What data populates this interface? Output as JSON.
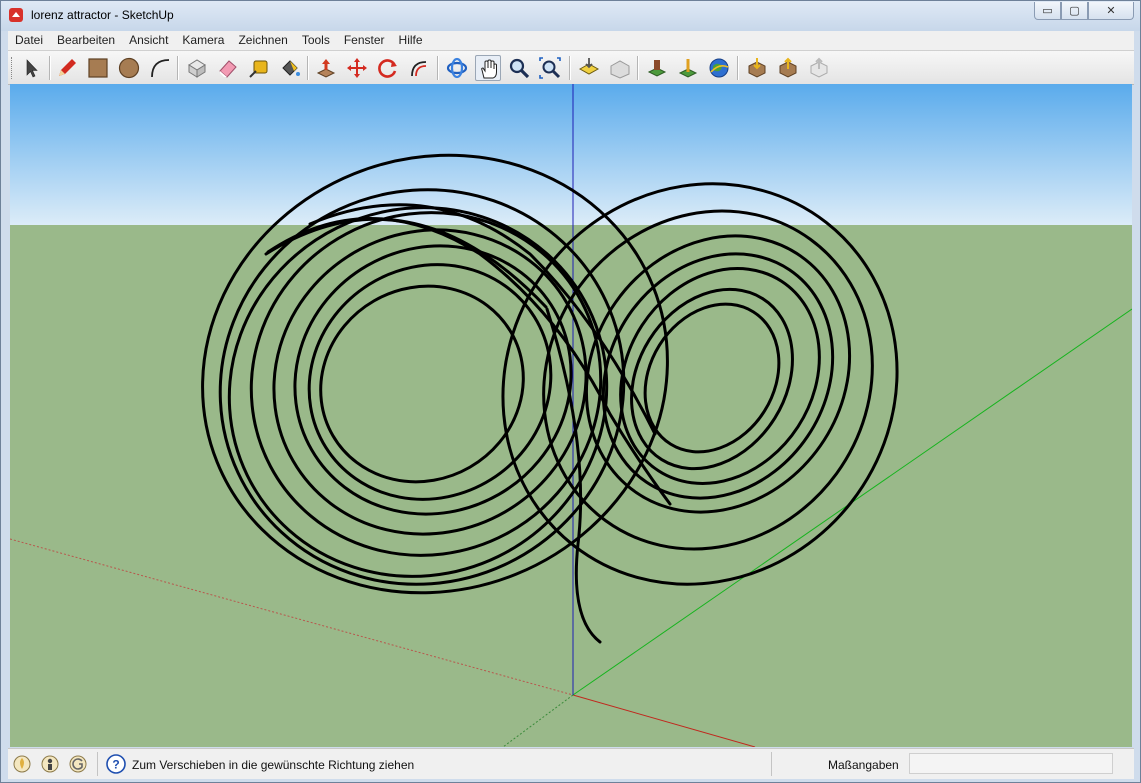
{
  "window": {
    "title": "lorenz attractor - SketchUp",
    "controls": {
      "minimize": "▭",
      "maximize": "▢",
      "close": "✕"
    }
  },
  "menu": [
    "Datei",
    "Bearbeiten",
    "Ansicht",
    "Kamera",
    "Zeichnen",
    "Tools",
    "Fenster",
    "Hilfe"
  ],
  "toolbar": {
    "tools": [
      "select-tool",
      "pencil-line-tool",
      "rectangle-tool",
      "circle-tool",
      "arc-tool",
      "make-component-tool",
      "eraser-tool",
      "tape-measure-tool",
      "paint-bucket-tool",
      "push-pull-tool",
      "move-tool",
      "rotate-tool",
      "offset-tool",
      "orbit-tool",
      "pan-tool",
      "zoom-tool",
      "zoom-extents-tool",
      "get-models-tool",
      "share-model-tool",
      "add-location-tool",
      "geo-toggle-tool",
      "google-earth-tool",
      "get-models-warehouse-tool",
      "share-component-tool",
      "send-to-layout-tool"
    ],
    "active_tool": "pan-tool"
  },
  "statusbar": {
    "hint": "Zum Verschieben in die gewünschte Richtung ziehen",
    "measurements_label": "Maßangaben",
    "measurements_value": ""
  },
  "colors": {
    "sky_top": "#5aabec",
    "sky_bottom": "#dcecf8",
    "ground": "#9ab98a",
    "axis_red": "#c0281e",
    "axis_green": "#16b41e",
    "axis_blue": "#1f1fb4",
    "curve": "#000000"
  }
}
